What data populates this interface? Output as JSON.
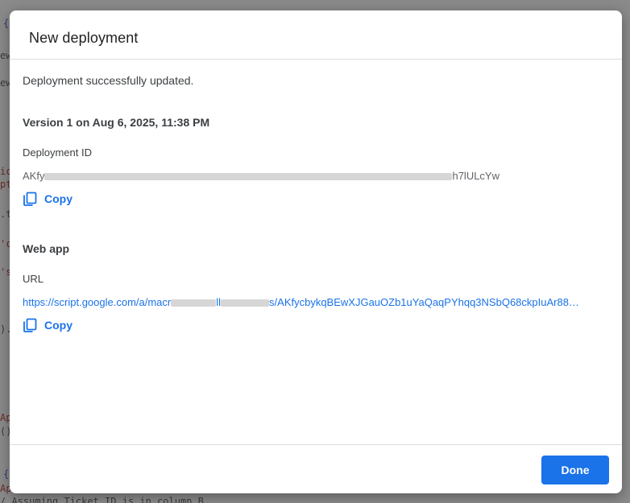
{
  "backdrop": {
    "lines": [
      "{",
      "ew",
      "ew",
      "ic",
      "pt",
      ".t",
      "'c",
      "'s",
      ").",
      "Ap",
      "()",
      "{",
      "Ap",
      "/ Assuming Ticket ID is in column B"
    ]
  },
  "dialog": {
    "title": "New deployment",
    "status": "Deployment successfully updated.",
    "version": "Version 1 on Aug 6, 2025, 11:38 PM",
    "deployment_id": {
      "label": "Deployment ID",
      "value_prefix": "AKfy",
      "value_suffix": "h7lULcYw",
      "copy_label": "Copy"
    },
    "web_app": {
      "title": "Web app",
      "url_label": "URL",
      "url_prefix": "https://script.google.com/a/macr",
      "url_middle": "ll",
      "url_suffix": "s/AKfycbykqBEwXJGauOZb1uYaQaqPYhqq3NSbQ68ckpIuAr88…",
      "copy_label": "Copy"
    },
    "done_label": "Done"
  },
  "colors": {
    "accent": "#1a73e8",
    "divider": "#dadce0",
    "overlay": "#8a8a8a"
  }
}
